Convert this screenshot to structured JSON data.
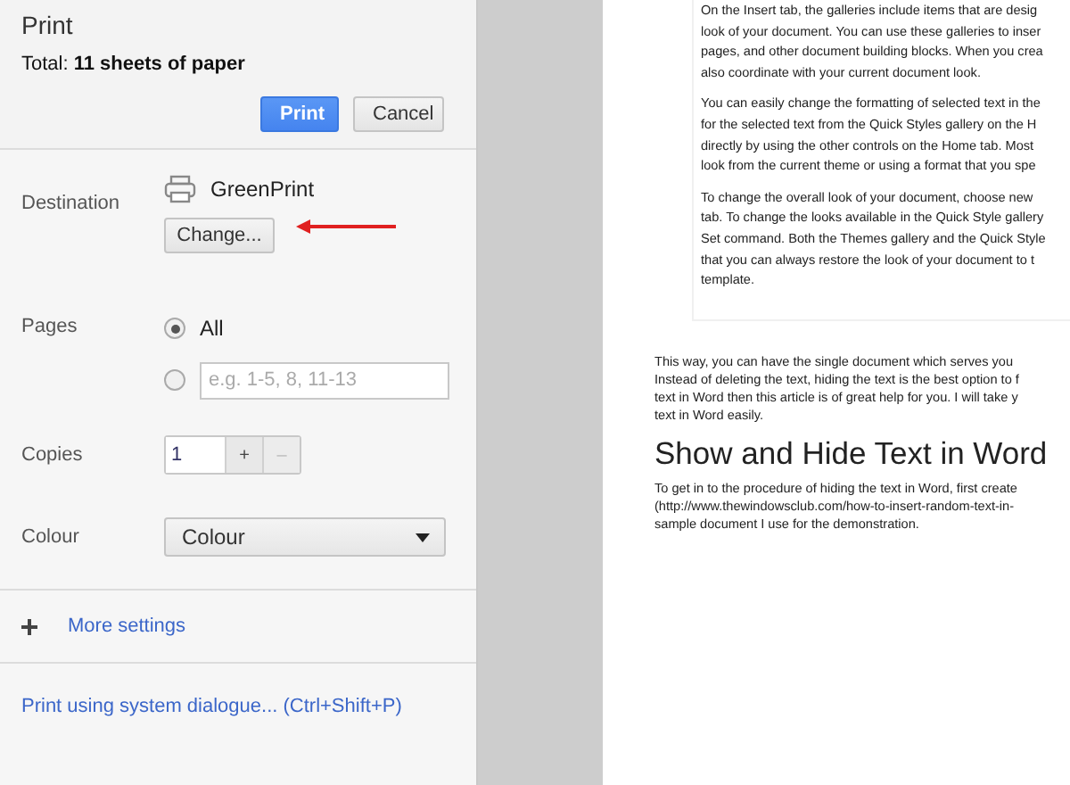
{
  "dialog": {
    "title": "Print",
    "total": "Total: **11 sheets of paper**",
    "buttons": [
      {
        "kind": "primary",
        "label": "Print"
      },
      {
        "kind": "secondary",
        "label": "Cancel"
      }
    ]
  },
  "destination": {
    "label": "Destination",
    "printer": "GreenPrint",
    "change_button": "Change..."
  },
  "pages": {
    "label": "Pages",
    "options": [
      {
        "kind": "all",
        "label": "All",
        "selected": true
      },
      {
        "kind": "custom",
        "placeholder": "e.g. 1-5, 8, 11-13",
        "selected": false
      }
    ]
  },
  "copies": {
    "label": "Copies",
    "value": "1",
    "increment": "+",
    "decrement": "–",
    "decrement_disabled": true
  },
  "colour": {
    "label": "Colour",
    "value": "Colour"
  },
  "more_settings": {
    "label": "More settings"
  },
  "system_dialog_link": "Print using system dialogue... (Ctrl+Shift+P)",
  "preview": {
    "embedded_paragraphs": [
      [
        "On the Insert tab, the galleries include items that are desig",
        "look of your document. You can use these galleries to inser",
        "pages, and other document building blocks. When you crea",
        "also coordinate with your current document look."
      ],
      [
        "You can easily change the formatting of selected text in the",
        "for the selected text from the Quick Styles gallery on the H",
        "directly by using the other controls on the Home tab. Most",
        "look from the current theme or using a format that you spe"
      ],
      [
        "To change the overall look of your document, choose new",
        "tab. To change the looks available in the Quick Style gallery",
        "Set command. Both the Themes gallery and the Quick Style",
        "that you can always restore the look of your document to t",
        "template."
      ]
    ],
    "intro_lines": [
      "This way, you can have the single document which serves you",
      "Instead of deleting the text, hiding the text is the best option to f",
      "text in Word then this article is of great help for you. I will take y",
      "text in Word easily."
    ],
    "heading": "Show and Hide Text in Word",
    "body_lines": [
      "To get in to the procedure of hiding the text in Word, first create",
      "(http://www.thewindowsclub.com/how-to-insert-random-text-in-",
      "sample document I use for the demonstration."
    ]
  }
}
